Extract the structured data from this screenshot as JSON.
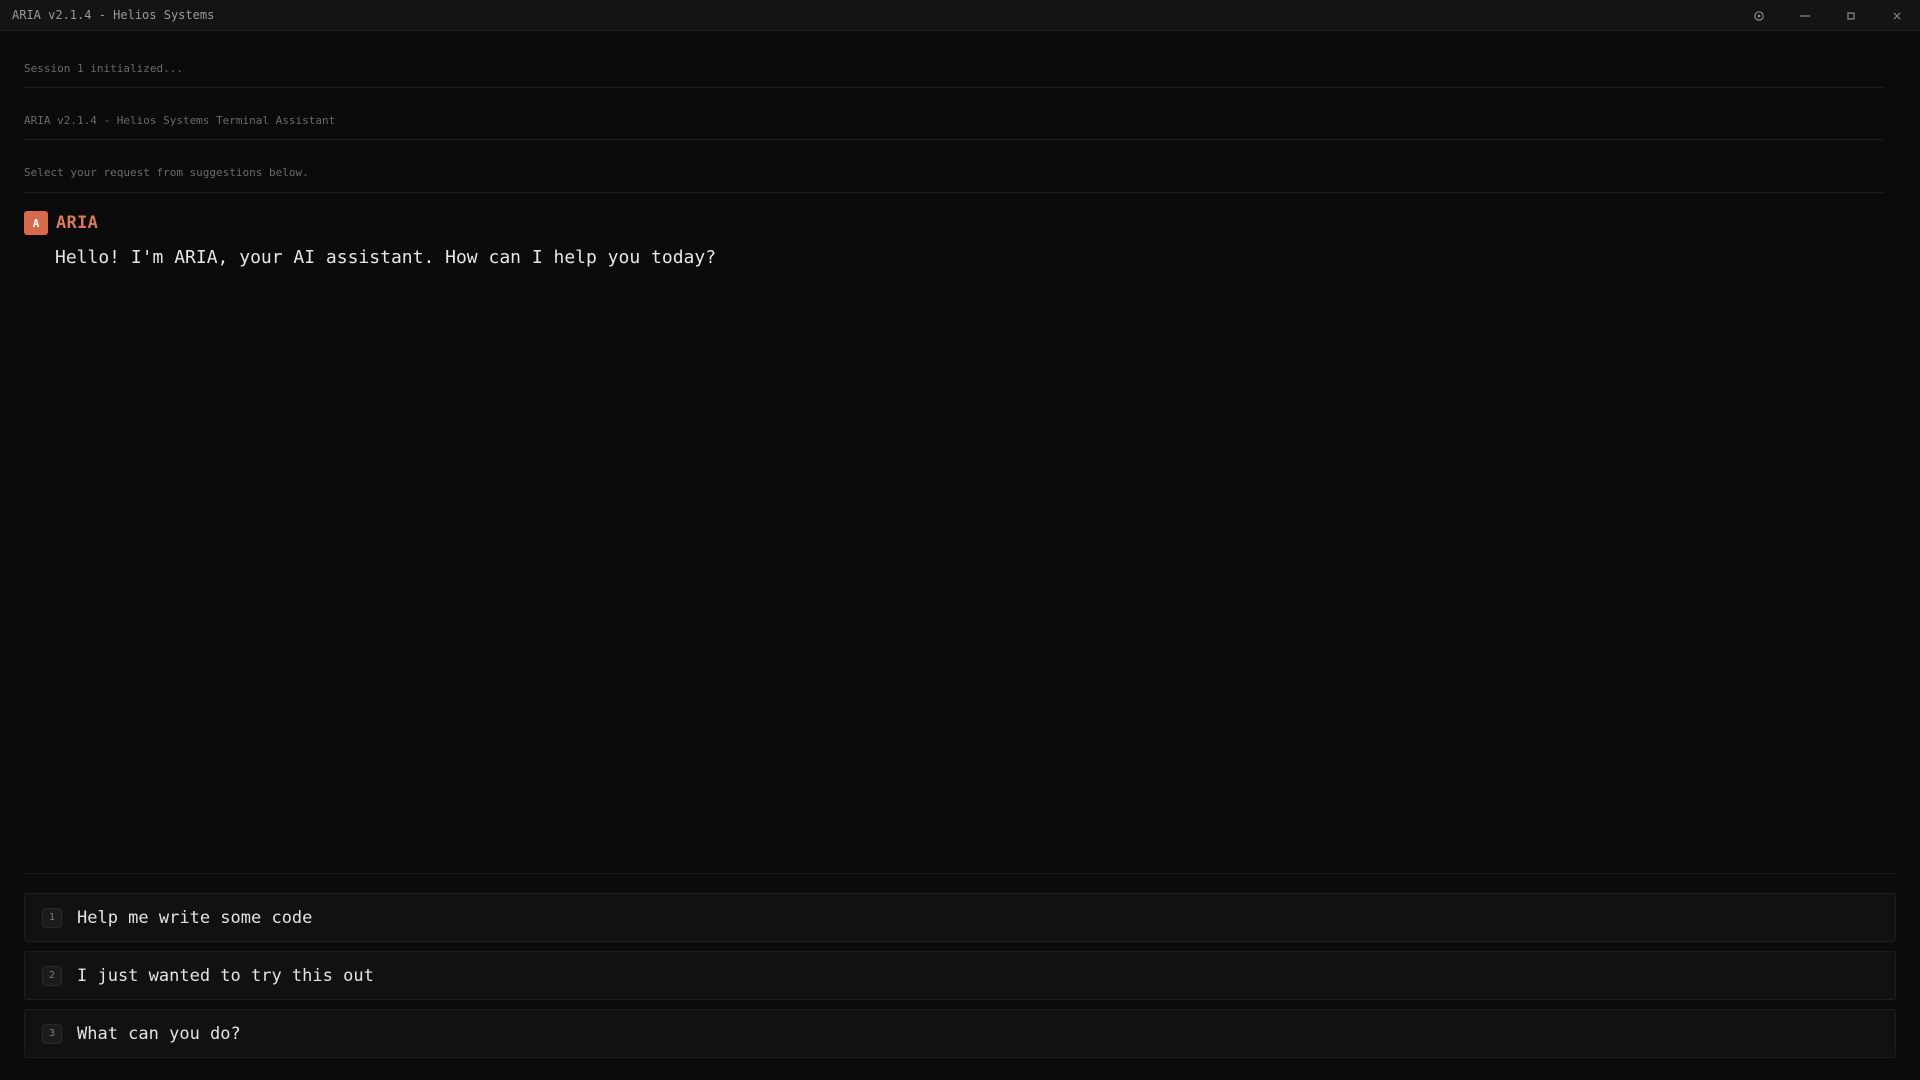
{
  "window": {
    "title": "ARIA v2.1.4 - Helios Systems",
    "controls": [
      {
        "name": "settings",
        "icon": "gear-icon"
      },
      {
        "name": "minimize",
        "icon": "minimize-icon",
        "glyph": "—"
      },
      {
        "name": "maximize",
        "icon": "maximize-icon"
      },
      {
        "name": "close",
        "icon": "close-icon",
        "glyph": "×"
      }
    ]
  },
  "system_lines": [
    "Session 1 initialized...",
    "ARIA v2.1.4 - Helios Systems Terminal Assistant",
    "Select your request from suggestions below."
  ],
  "message": {
    "avatar": "A",
    "sender": "ARIA",
    "text": "Hello! I'm ARIA, your AI assistant. How can I help you today?"
  },
  "suggestions": [
    {
      "num": "1",
      "label": "Help me write some code"
    },
    {
      "num": "2",
      "label": "I just wanted to try this out"
    },
    {
      "num": "3",
      "label": "What can you do?"
    }
  ],
  "colors": {
    "background": "#0b0b0b",
    "titlebar": "#141414",
    "accent": "#d56a4c",
    "sender": "#d9785a",
    "text": "#e6e6e6",
    "muted": "#6a6a6a"
  }
}
